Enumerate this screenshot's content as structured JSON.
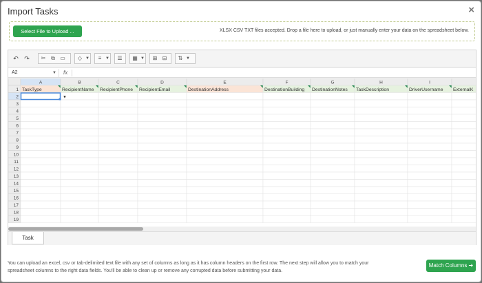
{
  "modal": {
    "title": "Import Tasks",
    "close_label": "×"
  },
  "upload": {
    "button_label": "Select File to Upload ...",
    "hint": "XLSX CSV TXT files accepted. Drop a file here to upload, or just manually enter your data on the spreadsheet below."
  },
  "toolbar": {
    "icons": [
      "undo-icon",
      "redo-icon",
      "cut-icon",
      "copy-icon",
      "paste-icon",
      "fill-color-icon",
      "align-icon",
      "wrap-icon",
      "merge-icon",
      "insert-row-icon",
      "insert-column-icon",
      "sort-icon"
    ]
  },
  "formula_bar": {
    "cell_ref": "A2",
    "fx_label": "fx"
  },
  "sheet": {
    "columns": [
      {
        "letter": "A",
        "header": "TaskType",
        "required": true
      },
      {
        "letter": "B",
        "header": "RecipientName",
        "required": false
      },
      {
        "letter": "C",
        "header": "RecipientPhone",
        "required": false
      },
      {
        "letter": "D",
        "header": "RecipientEmail",
        "required": false
      },
      {
        "letter": "E",
        "header": "DestinationAddress",
        "required": true
      },
      {
        "letter": "F",
        "header": "DestinationBuilding",
        "required": false
      },
      {
        "letter": "G",
        "header": "DestinationNotes",
        "required": false
      },
      {
        "letter": "H",
        "header": "TaskDescription",
        "required": false
      },
      {
        "letter": "I",
        "header": "DriverUsername",
        "required": false
      },
      {
        "letter": "",
        "header": "ExternalK",
        "required": false
      }
    ],
    "row_numbers": [
      "1",
      "2",
      "3",
      "4",
      "5",
      "6",
      "7",
      "8",
      "9",
      "10",
      "11",
      "12",
      "13",
      "14",
      "15",
      "16",
      "17",
      "18",
      "19"
    ],
    "active_cell": "A2",
    "dropdown_glyph": "▼"
  },
  "tabs": [
    {
      "label": "Task"
    }
  ],
  "footer": {
    "help_text": "You can upload an excel, csv or tab-delimited text file with any set of columns as long as it has column headers on the first row. The next step will allow you to match your spreadsheet columns to the right data fields. You'll be able to clean up or remove any corrupted data before submitting your data.",
    "match_button_label": "Match Columns ➔"
  },
  "colors": {
    "primary_button": "#2ea44f",
    "header_optional": "#e6f2df",
    "header_required": "#fbe4d6",
    "selection_blue": "#4a89dc"
  }
}
